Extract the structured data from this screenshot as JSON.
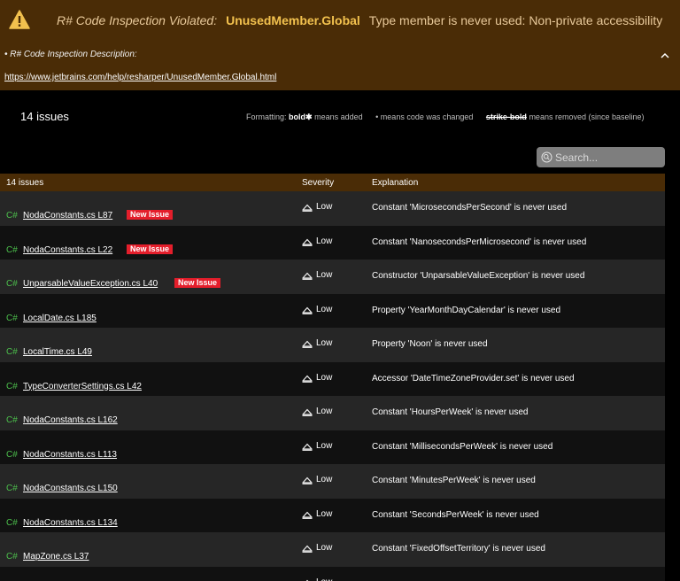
{
  "header": {
    "violated_label": "R# Code Inspection Violated:",
    "rule_name": "UnusedMember.Global",
    "rule_message": "Type member is never used: Non-private accessibility",
    "description_label": "• R# Code Inspection Description:",
    "doc_link": "https://www.jetbrains.com/help/resharper/UnusedMember.Global.html",
    "banner_color": "#4a2c06",
    "warning_color": "#f2c14e"
  },
  "summary": {
    "issue_count": "14 issues",
    "legend_prefix": "Formatting:",
    "legend_bold": "bold✱",
    "legend_bold_suffix": "means added",
    "legend_dot": "• means code was changed",
    "legend_strike": "strike-bold",
    "legend_strike_suffix": "means removed (since baseline)"
  },
  "search": {
    "placeholder": "Search..."
  },
  "table": {
    "headers": {
      "issues": "14 issues",
      "severity": "Severity",
      "explanation": "Explanation"
    },
    "language_tag": "C#",
    "new_badge": "New Issue",
    "rows": [
      {
        "file": "NodaConstants.cs L87",
        "is_new": true,
        "severity": "Low",
        "explanation": "Constant 'MicrosecondsPerSecond' is never used"
      },
      {
        "file": "NodaConstants.cs L22",
        "is_new": true,
        "severity": "Low",
        "explanation": "Constant 'NanosecondsPerMicrosecond' is never used"
      },
      {
        "file": "UnparsableValueException.cs L40",
        "is_new": true,
        "severity": "Low",
        "explanation": "Constructor 'UnparsableValueException' is never used"
      },
      {
        "file": "LocalDate.cs L185",
        "is_new": false,
        "severity": "Low",
        "explanation": "Property 'YearMonthDayCalendar' is never used"
      },
      {
        "file": "LocalTime.cs L49",
        "is_new": false,
        "severity": "Low",
        "explanation": "Property 'Noon' is never used"
      },
      {
        "file": "TypeConverterSettings.cs L42",
        "is_new": false,
        "severity": "Low",
        "explanation": "Accessor 'DateTimeZoneProvider.set' is never used"
      },
      {
        "file": "NodaConstants.cs L162",
        "is_new": false,
        "severity": "Low",
        "explanation": "Constant 'HoursPerWeek' is never used"
      },
      {
        "file": "NodaConstants.cs L113",
        "is_new": false,
        "severity": "Low",
        "explanation": "Constant 'MillisecondsPerWeek' is never used"
      },
      {
        "file": "NodaConstants.cs L150",
        "is_new": false,
        "severity": "Low",
        "explanation": "Constant 'MinutesPerWeek' is never used"
      },
      {
        "file": "NodaConstants.cs L134",
        "is_new": false,
        "severity": "Low",
        "explanation": "Constant 'SecondsPerWeek' is never used"
      },
      {
        "file": "MapZone.cs L37",
        "is_new": false,
        "severity": "Low",
        "explanation": "Constant 'FixedOffsetTerritory' is never used"
      },
      {
        "file": "",
        "is_new": false,
        "severity": "Low",
        "explanation": ""
      }
    ]
  }
}
